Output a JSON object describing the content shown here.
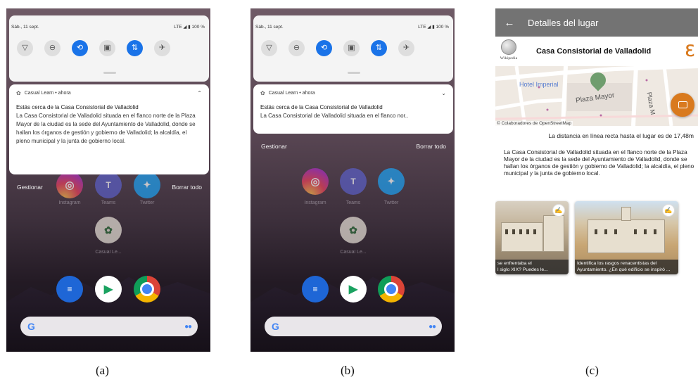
{
  "captions": [
    "(a)",
    "(b)",
    "(c)"
  ],
  "status_bar": {
    "date": "Sáb., 11 sept.",
    "status": "LTE ◢ ▮ 100 %"
  },
  "quick_tiles": [
    "wifi-icon",
    "dnd-icon",
    "auto-rotate-icon",
    "battery-saver-icon",
    "mobile-data-icon",
    "airplane-icon"
  ],
  "notification": {
    "header": "Casual Learn • ahora",
    "title": "Estás cerca de la Casa Consistorial de Valladolid",
    "body_full": "La Casa Consistorial de Valladolid situada en el flanco norte de la Plaza Mayor de la ciudad es la sede del Ayuntamiento de Valladolid, donde se hallan los órganos de gestión y gobierno de Valladolid; la alcaldía, el pleno municipal y la junta de gobierno local.",
    "body_collapsed": "La Casa Consistorial de Valladolid situada en el flanco nor.."
  },
  "shade_actions": {
    "manage": "Gestionar",
    "clear_all": "Borrar todo"
  },
  "home_apps": {
    "instagram": "Instagram",
    "teams": "Teams",
    "twitter": "Twitter",
    "casual_learn": "Casual Le..."
  },
  "detail": {
    "appbar_title": "Detalles del lugar",
    "wikipedia_label": "Wikipedia",
    "place_name": "Casa Consistorial de Valladolid",
    "map": {
      "hotel_label": "Hotel Imperial",
      "plaza_label": "Plaza Mayor",
      "plaza_label_2": "Plaza M",
      "credit": "© Colaboradores de OpenStreetMap"
    },
    "distance": "La distancia en línea recta hasta el lugar es de 17,48m",
    "description": "La Casa Consistorial de Valladolid situada en el flanco norte de la Plaza Mayor de la ciudad es la sede del Ayuntamiento de Valladolid, donde se hallan los órganos de gestión y gobierno de Valladolid; la alcaldía, el pleno municipal y la junta de gobierno local.",
    "cards": [
      {
        "caption_line1": "se enfrentaba el",
        "caption_line2": "l siglo XIX? Puedes le..."
      },
      {
        "caption_line1": "Identifica los rasgos renacentistas del",
        "caption_line2": "Ayuntamiento. ¿En qué edificio se inspiró ..."
      }
    ]
  },
  "colors": {
    "accent_blue": "#1a73e8",
    "accent_orange": "#d97a1e",
    "appbar_grey": "#737373"
  }
}
